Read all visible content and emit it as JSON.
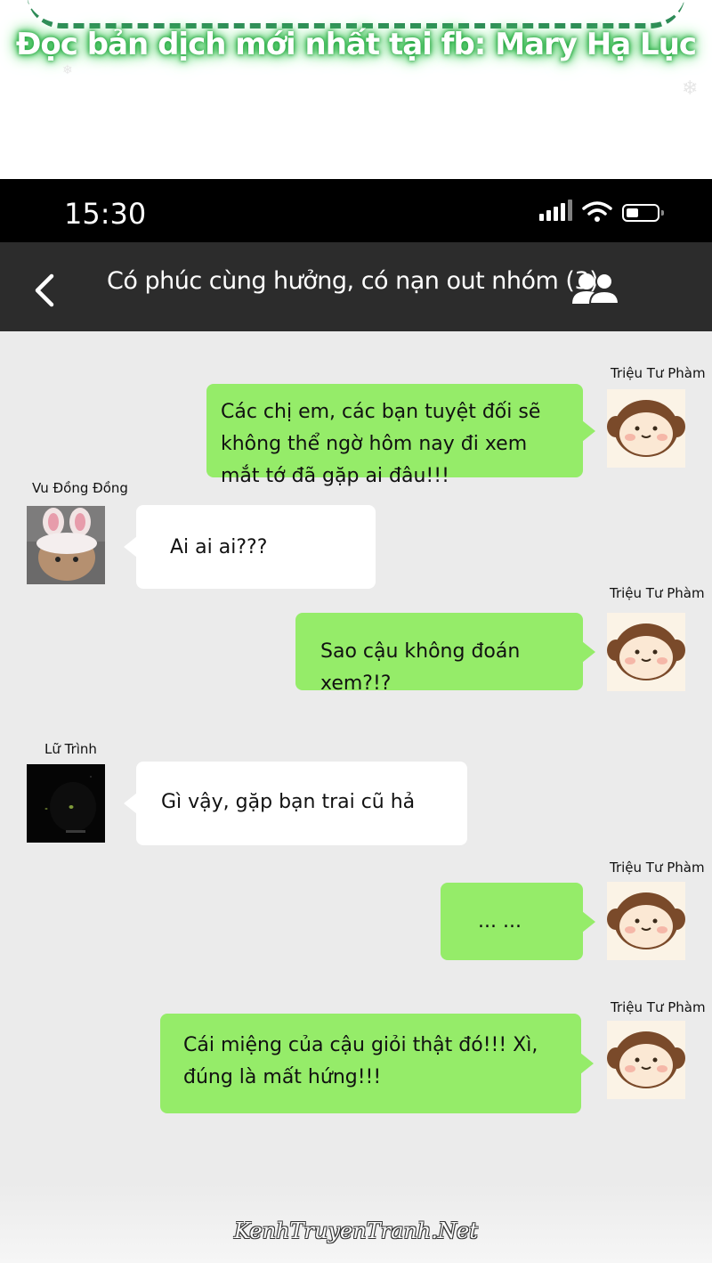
{
  "banner": {
    "text": "Đọc bản dịch mới nhất tại fb: Mary Hạ Lục"
  },
  "status_bar": {
    "time": "15:30"
  },
  "header": {
    "title": "Có phúc cùng hưởng, có nạn out nhóm (3)"
  },
  "messages": [
    {
      "sender": "Triệu Tư Phàm",
      "side": "right",
      "text": "Các chị em, các bạn tuyệt đối sẽ không thể ngờ hôm nay đi xem mắt tớ đã gặp ai đâu!!!"
    },
    {
      "sender": "Vu Đồng Đồng",
      "side": "left",
      "text": "Ai ai ai???"
    },
    {
      "sender": "Triệu Tư Phàm",
      "side": "right",
      "text": "Sao cậu không đoán xem?!?"
    },
    {
      "sender": "Lữ Trình",
      "side": "left",
      "text": "Gì vậy, gặp bạn trai cũ hả"
    },
    {
      "sender": "Triệu Tư Phàm",
      "side": "right",
      "text": "... ..."
    },
    {
      "sender": "Triệu Tư Phàm",
      "side": "right",
      "text": "Cái miệng của cậu giỏi thật đó!!! Xì, đúng là mất hứng!!!"
    }
  ],
  "watermark": "KenhTruyenTranh.Net",
  "colors": {
    "bubble_green": "#95ec69",
    "nav_bg": "#2c2c2c",
    "chat_bg": "#ebebeb"
  }
}
